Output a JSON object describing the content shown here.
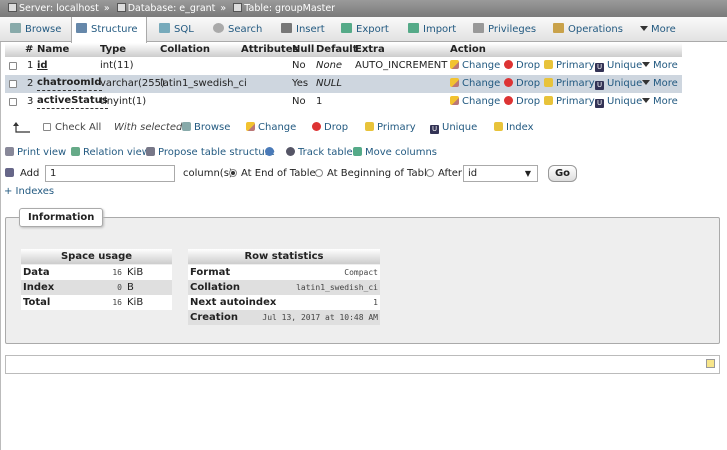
{
  "breadcrumb": {
    "server": "Server: localhost",
    "database": "Database: e_grant",
    "table": "Table: groupMaster",
    "sep": "»"
  },
  "tabs": [
    {
      "label": "Browse",
      "icon": "browse-icon"
    },
    {
      "label": "Structure",
      "icon": "structure-icon",
      "active": true
    },
    {
      "label": "SQL",
      "icon": "sql-icon"
    },
    {
      "label": "Search",
      "icon": "search-icon"
    },
    {
      "label": "Insert",
      "icon": "insert-icon"
    },
    {
      "label": "Export",
      "icon": "export-icon"
    },
    {
      "label": "Import",
      "icon": "import-icon"
    },
    {
      "label": "Privileges",
      "icon": "privileges-icon"
    },
    {
      "label": "Operations",
      "icon": "operations-icon"
    },
    {
      "label": "More",
      "icon": "chevron-down-icon"
    }
  ],
  "columns": {
    "num": "#",
    "name": "Name",
    "type": "Type",
    "collation": "Collation",
    "attributes": "Attributes",
    "null": "Null",
    "default": "Default",
    "extra": "Extra",
    "action": "Action"
  },
  "rows": [
    {
      "num": "1",
      "name": "id",
      "type": "int(11)",
      "collation": "",
      "null": "No",
      "default": "None",
      "extra": "AUTO_INCREMENT"
    },
    {
      "num": "2",
      "name": "chatroomId",
      "type": "varchar(255)",
      "collation": "latin1_swedish_ci",
      "null": "Yes",
      "default": "NULL",
      "extra": ""
    },
    {
      "num": "3",
      "name": "activeStatus",
      "type": "tinyint(1)",
      "collation": "",
      "null": "No",
      "default": "1",
      "extra": ""
    }
  ],
  "actions": {
    "change": "Change",
    "drop": "Drop",
    "primary": "Primary",
    "unique": "Unique",
    "more": "More"
  },
  "with_selected": {
    "check_all": "Check All",
    "label": "With selected:",
    "browse": "Browse",
    "change": "Change",
    "drop": "Drop",
    "primary": "Primary",
    "unique": "Unique",
    "index": "Index"
  },
  "links": {
    "print_view": "Print view",
    "relation_view": "Relation view",
    "propose": "Propose table structure",
    "track": "Track table",
    "move": "Move columns"
  },
  "add": {
    "label": "Add",
    "count": "1",
    "columns_label": "column(s)",
    "at_end": "At End of Table",
    "at_beginning": "At Beginning of Table",
    "after": "After",
    "after_value": "id",
    "go": "Go"
  },
  "indexes": "+ Indexes",
  "information": {
    "legend": "Information",
    "space_usage": {
      "title": "Space usage",
      "rows": [
        {
          "label": "Data",
          "value": "16",
          "unit": "KiB"
        },
        {
          "label": "Index",
          "value": "0",
          "unit": "B"
        },
        {
          "label": "Total",
          "value": "16",
          "unit": "KiB"
        }
      ]
    },
    "row_statistics": {
      "title": "Row statistics",
      "rows": [
        {
          "label": "Format",
          "value": "Compact"
        },
        {
          "label": "Collation",
          "value": "latin1_swedish_ci"
        },
        {
          "label": "Next autoindex",
          "value": "1"
        },
        {
          "label": "Creation",
          "value": "Jul 13, 2017 at 10:48 AM"
        }
      ]
    }
  },
  "colors": {
    "link": "#235a81",
    "selected_row": "#ced6df",
    "drop": "#dd3333"
  }
}
